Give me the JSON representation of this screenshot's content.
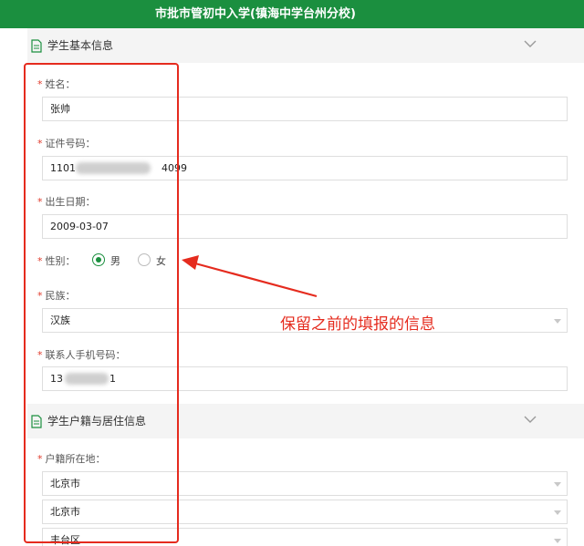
{
  "header": {
    "title": "市批市管初中入学(镇海中学台州分校)"
  },
  "sections": [
    {
      "title": "学生基本信息",
      "icon": "document-icon",
      "toggle_icon": "chevron-down-icon"
    },
    {
      "title": "学生户籍与居住信息",
      "icon": "document-icon",
      "toggle_icon": "chevron-down-icon"
    }
  ],
  "form": {
    "required_mark": "*",
    "name": {
      "label": "姓名：",
      "value": "张帅"
    },
    "id_number": {
      "label": "证件号码：",
      "value_prefix": "1101",
      "value_suffix": "4099"
    },
    "birth_date": {
      "label": "出生日期：",
      "value": "2009-03-07"
    },
    "gender": {
      "label": "性别：",
      "options": [
        "男",
        "女"
      ],
      "selected": "男"
    },
    "ethnicity": {
      "label": "民族：",
      "value": "汉族"
    },
    "phone": {
      "label": "联系人手机号码：",
      "value_prefix": "13",
      "value_suffix": "1"
    },
    "household": {
      "label": "户籍所在地：",
      "province": "北京市",
      "city": "北京市",
      "district": "丰台区"
    }
  },
  "annotation": {
    "text": "保留之前的填报的信息",
    "color": "#e52b1e"
  },
  "colors": {
    "brand": "#1b8f3f",
    "required": "#e03a2b",
    "annotation": "#e52b1e"
  }
}
